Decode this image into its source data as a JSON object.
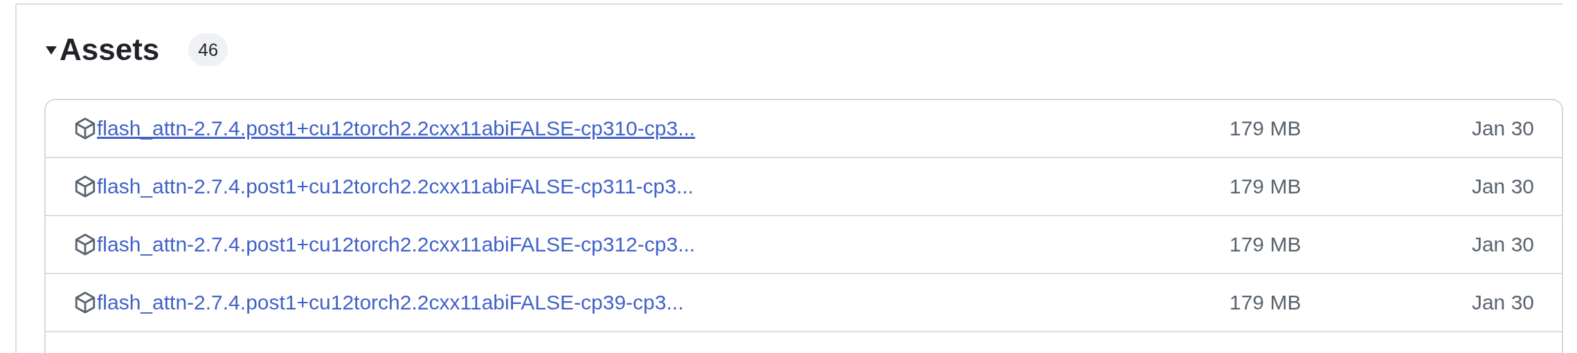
{
  "section": {
    "title": "Assets",
    "expanded": true,
    "count": "46"
  },
  "assets": [
    {
      "name": "flash_attn-2.7.4.post1+cu12torch2.2cxx11abiFALSE-cp310-cp3...",
      "size": "179 MB",
      "date": "Jan 30",
      "hovered": true
    },
    {
      "name": "flash_attn-2.7.4.post1+cu12torch2.2cxx11abiFALSE-cp311-cp3...",
      "size": "179 MB",
      "date": "Jan 30",
      "hovered": false
    },
    {
      "name": "flash_attn-2.7.4.post1+cu12torch2.2cxx11abiFALSE-cp312-cp3...",
      "size": "179 MB",
      "date": "Jan 30",
      "hovered": false
    },
    {
      "name": "flash_attn-2.7.4.post1+cu12torch2.2cxx11abiFALSE-cp39-cp3...",
      "size": "179 MB",
      "date": "Jan 30",
      "hovered": false
    }
  ]
}
